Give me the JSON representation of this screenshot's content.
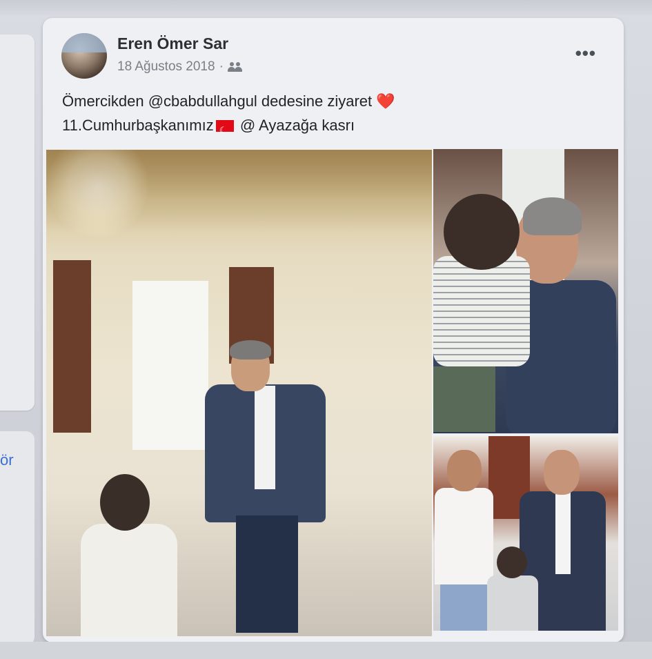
{
  "left_panel": {
    "link_fragment": "ör"
  },
  "post": {
    "author": "Eren Ömer Sar",
    "date": "18 Ağustos 2018",
    "separator": "·",
    "audience_icon": "friends-icon",
    "more_icon": "more-options-icon",
    "more_label": "•••",
    "caption_line1": "Ömercikden @cbabdullahgul dedesine ziyaret",
    "caption_line1_emoji": "❤️",
    "caption_line2_a": "11.Cumhurbaşkanımız",
    "caption_line2_flag": "flag-turkey-icon",
    "caption_line2_b": "@ Ayazağa kasrı",
    "photos": [
      {
        "name": "photo-main"
      },
      {
        "name": "photo-hug"
      },
      {
        "name": "photo-group"
      }
    ]
  }
}
